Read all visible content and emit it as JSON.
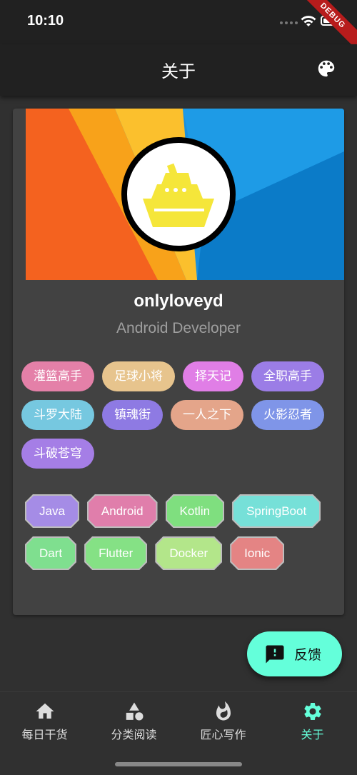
{
  "status_bar": {
    "time": "10:10",
    "debug_label": "DEBUG"
  },
  "app_bar": {
    "title": "关于",
    "action_icon": "palette-icon"
  },
  "profile": {
    "username": "onlyloveyd",
    "role": "Android Developer",
    "avatar_icon": "ship-icon",
    "avatar_color": "#f5e63a"
  },
  "anime_tags": [
    {
      "label": "灌篮高手",
      "color": "#e480a8"
    },
    {
      "label": "足球小将",
      "color": "#e7c48d"
    },
    {
      "label": "择天记",
      "color": "#e07ee6"
    },
    {
      "label": "全职高手",
      "color": "#9b7de6"
    },
    {
      "label": "斗罗大陆",
      "color": "#76c8e0"
    },
    {
      "label": "镇魂街",
      "color": "#8e7ae3"
    },
    {
      "label": "一人之下",
      "color": "#e4a58a"
    },
    {
      "label": "火影忍者",
      "color": "#7f95e8"
    },
    {
      "label": "斗破苍穹",
      "color": "#a57ee6"
    }
  ],
  "skill_tags": [
    {
      "label": "Java",
      "color": "#a58ce6"
    },
    {
      "label": "Android",
      "color": "#e07eab"
    },
    {
      "label": "Kotlin",
      "color": "#7fdf7f"
    },
    {
      "label": "SpringBoot",
      "color": "#76e0d8"
    },
    {
      "label": "Dart",
      "color": "#7fdf8f"
    },
    {
      "label": "Flutter",
      "color": "#85e185"
    },
    {
      "label": "Docker",
      "color": "#b3e68a"
    },
    {
      "label": "Ionic",
      "color": "#e48484"
    }
  ],
  "fab": {
    "label": "反馈",
    "icon": "feedback-icon"
  },
  "bottom_nav": {
    "items": [
      {
        "label": "每日干货",
        "icon": "home-icon",
        "active": false
      },
      {
        "label": "分类阅读",
        "icon": "category-icon",
        "active": false
      },
      {
        "label": "匠心写作",
        "icon": "flame-icon",
        "active": false
      },
      {
        "label": "关于",
        "icon": "settings-icon",
        "active": true
      }
    ]
  },
  "colors": {
    "accent": "#64ffda",
    "appbar": "#212121",
    "background": "#303030",
    "card": "#424242"
  }
}
